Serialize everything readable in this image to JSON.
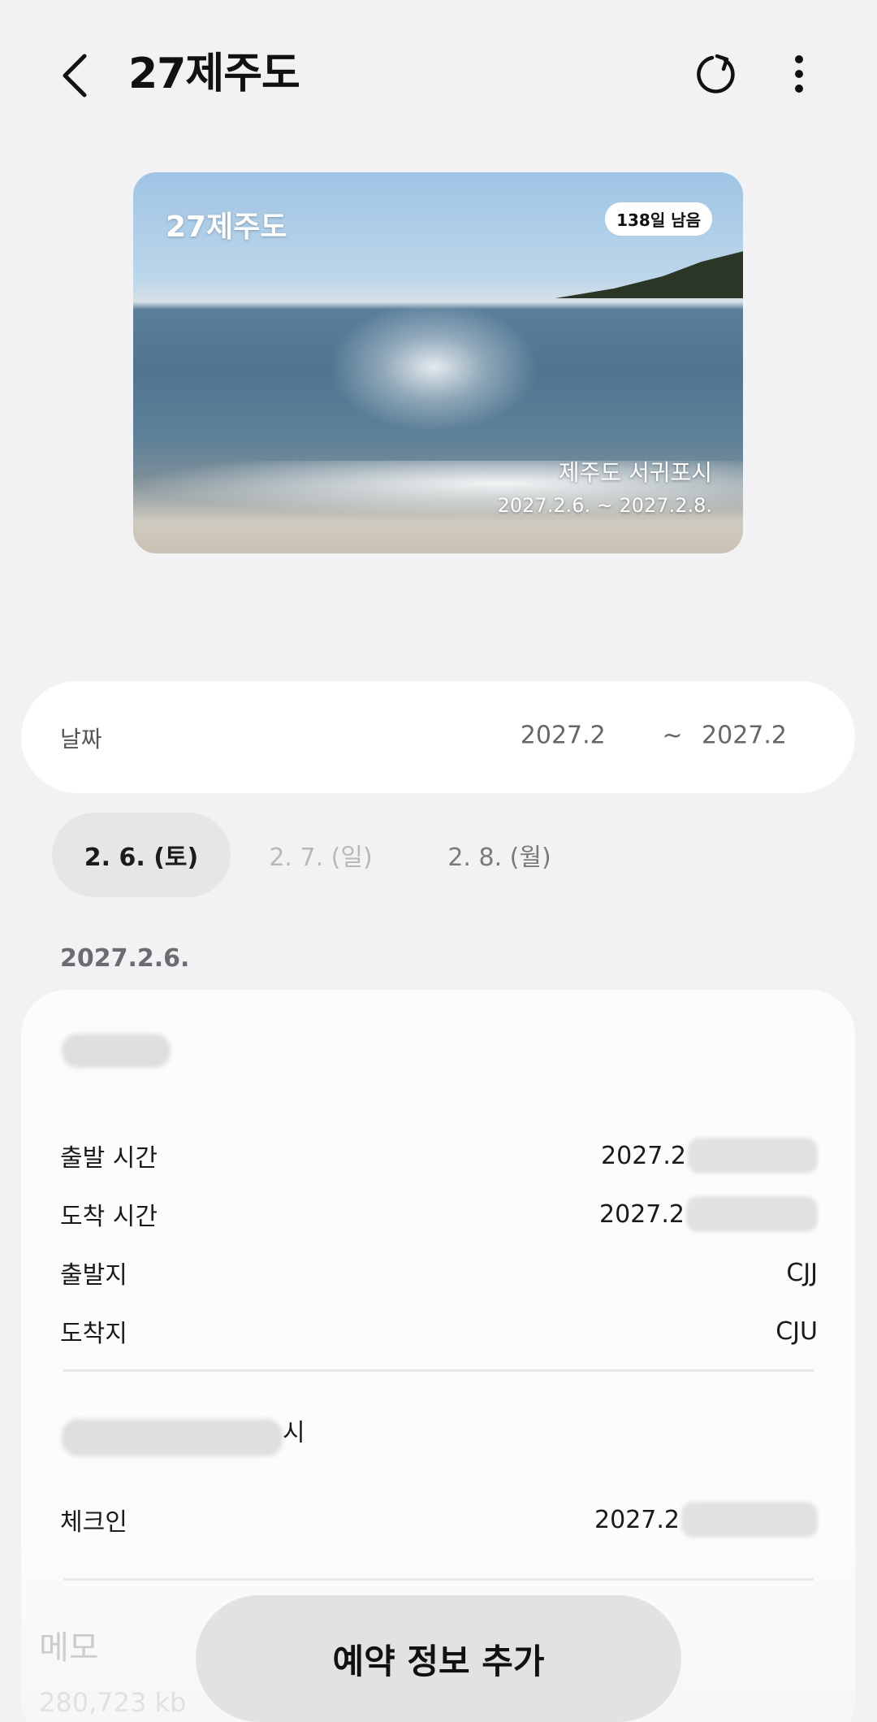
{
  "header": {
    "title": "27제주도",
    "back_icon": "back-arrow-icon",
    "refresh_icon": "refresh-icon",
    "more_icon": "more-vertical-icon"
  },
  "trip_card": {
    "title": "27제주도",
    "badge": "138일 남음",
    "location": "제주도 서귀포시",
    "dates": "2027.2.6. ~ 2027.2.8."
  },
  "date_row": {
    "label": "날짜",
    "start": "2027.2",
    "separator": "~",
    "end": "2027.2"
  },
  "tabs": [
    {
      "label": "2. 6. (토)"
    },
    {
      "label": "2. 7. (일)"
    },
    {
      "label": "2. 8. (월)"
    }
  ],
  "day_heading": "2027.2.6.",
  "flight": {
    "rows": [
      {
        "label": "출발 시간",
        "value": "2027.2"
      },
      {
        "label": "도착 시간",
        "value": "2027.2"
      },
      {
        "label": "출발지",
        "value": "CJJ"
      },
      {
        "label": "도착지",
        "value": "CJU"
      }
    ]
  },
  "hotel": {
    "title_suffix": "시",
    "rows": [
      {
        "label": "체크인",
        "value": "2027.2"
      }
    ]
  },
  "memo": {
    "label": "메모",
    "value": "280,723 kb"
  },
  "add_button": "예약 정보 추가"
}
